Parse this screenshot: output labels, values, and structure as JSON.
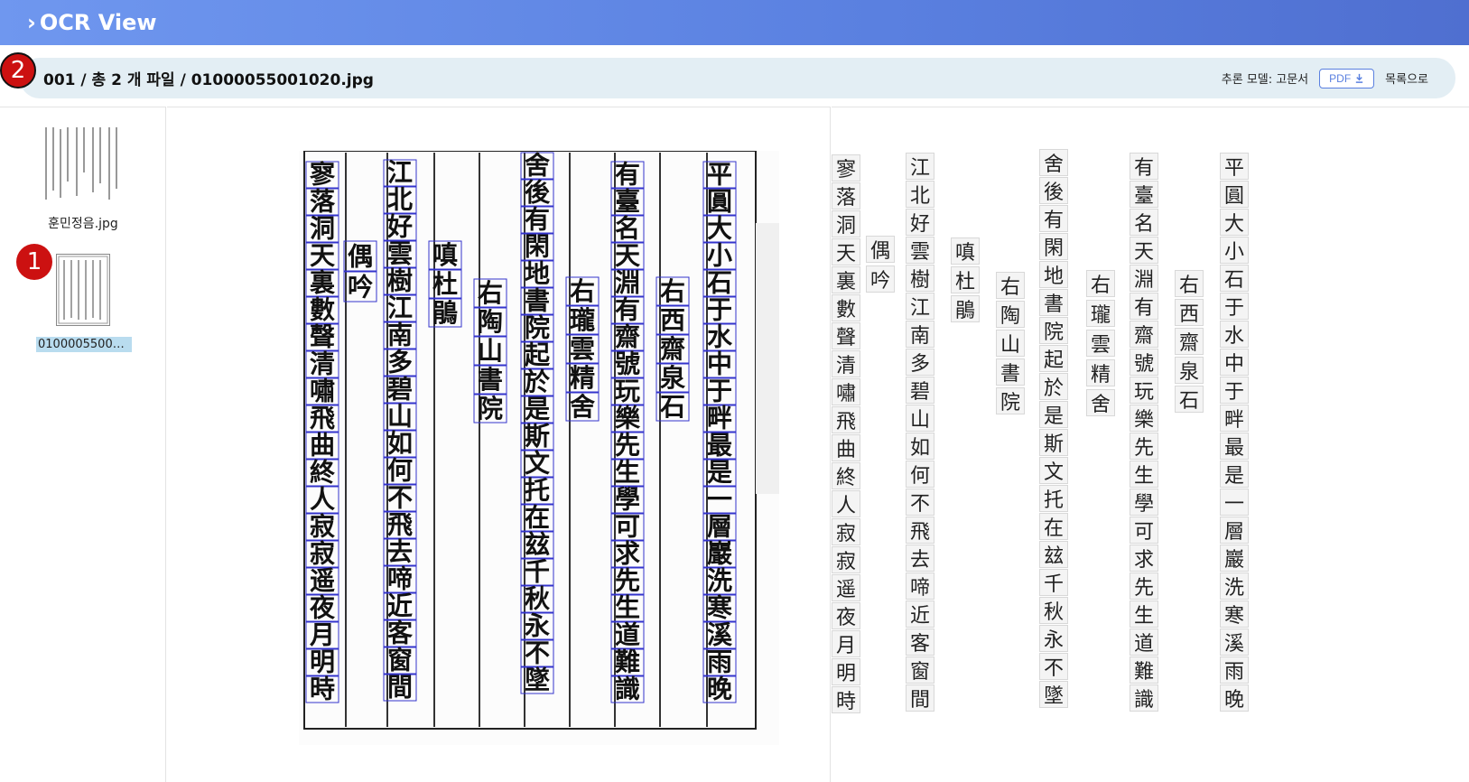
{
  "header": {
    "chevron": "›",
    "title": "OCR View"
  },
  "infobar": {
    "path": "001 / 총 2 개 파일 / 01000055001020.jpg",
    "model_label": "추론 모델: 고문서",
    "pdf_label": "PDF",
    "back_label": "목록으로"
  },
  "badges": {
    "one": "1",
    "two": "2"
  },
  "sidebar": {
    "files": [
      {
        "label": "훈민정음.jpg"
      },
      {
        "label": "010000550010..."
      }
    ]
  },
  "colors": {
    "accent": "#5a80e0",
    "badge": "#cc1111",
    "selected": "#b9dcef",
    "ocr_box": "#3333cc"
  },
  "icons": {
    "chevron": "chevron-right-icon",
    "download": "download-icon"
  },
  "columns": [
    {
      "chars": [
        "平",
        "圓",
        "大",
        "小",
        "石",
        "于",
        "水",
        "中",
        "于",
        "畔",
        "最",
        "是",
        "一",
        "層",
        "巖",
        "洗",
        "寒",
        "溪",
        "雨",
        "晚"
      ]
    },
    {
      "chars": [
        "右",
        "西",
        "齋",
        "泉",
        "石"
      ]
    },
    {
      "chars": [
        "有",
        "臺",
        "名",
        "天",
        "淵",
        "有",
        "齋",
        "號",
        "玩",
        "樂",
        "先",
        "生",
        "學",
        "可",
        "求",
        "先",
        "生",
        "道",
        "難",
        "識"
      ]
    },
    {
      "chars": [
        "右",
        "瓏",
        "雲",
        "精",
        "舍"
      ]
    },
    {
      "chars": [
        "舍",
        "後",
        "有",
        "閑",
        "地",
        "書",
        "院",
        "起",
        "於",
        "是",
        "斯",
        "文",
        "托",
        "在",
        "玆",
        "千",
        "秋",
        "永",
        "不",
        "墜"
      ]
    },
    {
      "chars": [
        "右",
        "陶",
        "山",
        "書",
        "院"
      ]
    },
    {
      "chars": [
        "嗔",
        "杜",
        "鵑"
      ]
    },
    {
      "chars": [
        "江",
        "北",
        "好",
        "雲",
        "樹",
        "江",
        "南",
        "多",
        "碧",
        "山",
        "如",
        "何",
        "不",
        "飛",
        "去",
        "啼",
        "近",
        "客",
        "窗",
        "間"
      ]
    },
    {
      "chars": [
        "偶",
        "吟"
      ]
    },
    {
      "chars": [
        "寥",
        "落",
        "洞",
        "天",
        "裏",
        "數",
        "聲",
        "清",
        "嘯",
        "飛",
        "曲",
        "終",
        "人",
        "寂",
        "寂",
        "遥",
        "夜",
        "月",
        "明",
        "時"
      ]
    }
  ]
}
